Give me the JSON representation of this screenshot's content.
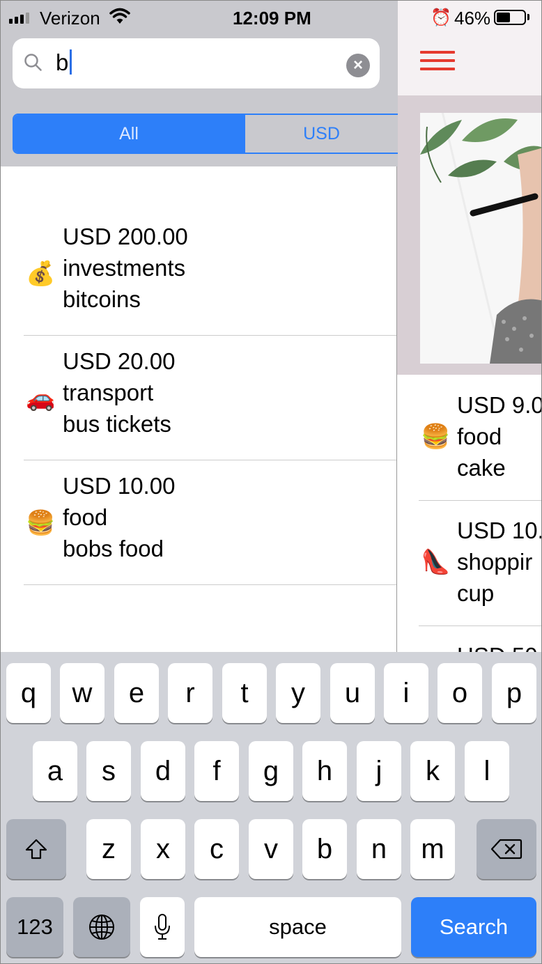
{
  "status_bar": {
    "carrier": "Verizon",
    "time": "12:09 PM",
    "battery_percent": "46%",
    "battery_level": 0.46,
    "wifi_icon": "wifi-icon",
    "alarm_icon": "alarm-icon"
  },
  "search": {
    "query": "b",
    "search_icon": "magnifying-glass-icon",
    "clear_icon": "clear-x-icon"
  },
  "scope": {
    "all_label": "All",
    "usd_label": "USD",
    "selected": "All"
  },
  "results": [
    {
      "emoji": "💰",
      "icon": "money-bag-icon",
      "amount": "USD 200.00",
      "category": "investments",
      "description": "bitcoins"
    },
    {
      "emoji": "🚗",
      "icon": "car-icon",
      "amount": "USD 20.00",
      "category": "transport",
      "description": "bus tickets"
    },
    {
      "emoji": "🍔",
      "icon": "burger-icon",
      "amount": "USD 10.00",
      "category": "food",
      "description": "bobs food"
    }
  ],
  "background_app": {
    "menu_icon": "hamburger-menu-icon",
    "items": [
      {
        "emoji": "🍔",
        "icon": "burger-icon",
        "amount": "USD 9.0",
        "category": "food",
        "description": "cake"
      },
      {
        "emoji": "👠",
        "icon": "high-heel-icon",
        "amount": "USD 10.",
        "category": "shoppir",
        "description": "cup"
      },
      {
        "emoji": "",
        "icon": "",
        "amount": "USD 50",
        "category": "",
        "description": ""
      }
    ]
  },
  "keyboard": {
    "row1": [
      "q",
      "w",
      "e",
      "r",
      "t",
      "y",
      "u",
      "i",
      "o",
      "p"
    ],
    "row2": [
      "a",
      "s",
      "d",
      "f",
      "g",
      "h",
      "j",
      "k",
      "l"
    ],
    "row3": [
      "z",
      "x",
      "c",
      "v",
      "b",
      "n",
      "m"
    ],
    "numbers_label": "123",
    "space_label": "space",
    "search_label": "Search",
    "shift_icon": "shift-icon",
    "delete_icon": "backspace-icon",
    "globe_icon": "globe-icon",
    "mic_icon": "microphone-icon"
  },
  "colors": {
    "accent": "#2d7ff9",
    "menu_red": "#e53a2f",
    "header_gray": "#c9c9ce",
    "keyboard_bg": "#d1d3d9"
  }
}
